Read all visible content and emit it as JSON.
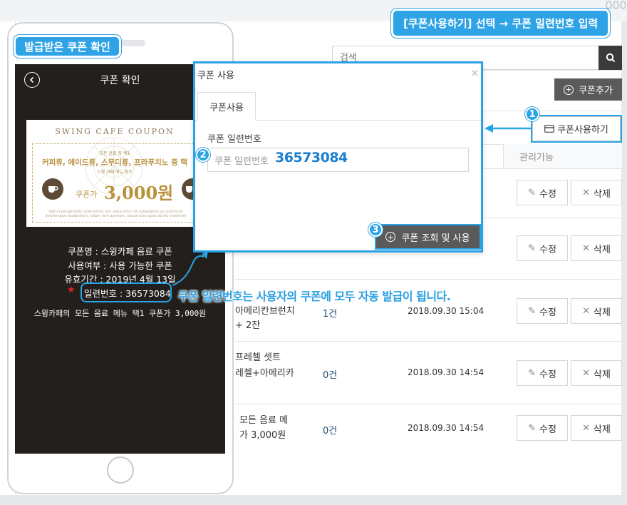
{
  "annotations": {
    "phone_tag": "발급받은 쿠폰 확인",
    "top_tag": "[쿠폰사용하기] 선택 → 쿠폰 일련번호 입력",
    "caption": "쿠폰 일련번호는 사용자의 쿠폰에 모두 자동 발급이 됩니다.",
    "step1": "1",
    "step2": "2",
    "step3": "3"
  },
  "phone": {
    "screen_title": "쿠폰 확인",
    "coupon": {
      "brand": "SWING CAFE COUPON",
      "subtitle": "모든 음료 중 택1",
      "menu": "커피류, 에이드류, 스무디류, 프라푸치노 중 택",
      "note": "스윙 카페 메뉴 참조",
      "price_label": "쿠폰가",
      "price": "3,000원",
      "fineprint": "Sed ut perspiciatis unde omnis iste natus error sit voluptatem accusantium doloremque laudantium, totam rem aperiam, eaque ipsa quae ab illo inventore"
    },
    "info": {
      "name": "쿠폰명 : 스윙카페 음료 쿠폰",
      "status": "사용여부 : 사용 가능한 쿠폰",
      "validity": "유효기간 : 2019년 4월 13일",
      "serial": "일련번호 : 36573084",
      "summary": "스윙카페의 모든 음료 메뉴 택1 쿠폰가 3,000원"
    }
  },
  "admin": {
    "search_placeholder": "검색",
    "add_coupon": "쿠폰추가",
    "use_coupon": "쿠폰사용하기",
    "col_mgmt": "관리기능",
    "edit": "수정",
    "delete": "삭제",
    "rows": [
      {
        "text1": "아메리칸브런치",
        "text2": "+ 2잔",
        "count": "1건",
        "date": "2018.09.30 15:04"
      },
      {
        "text1": "프레첼 셋트",
        "text2": "레첼+아메리카",
        "count": "0건",
        "date": "2018.09.30 14:54"
      },
      {
        "text1": "모든 음료 메",
        "text2": "가 3,000원",
        "count": "0건",
        "date": "2018.09.30 14:54"
      }
    ]
  },
  "modal": {
    "title": "쿠폰 사용",
    "close": "×",
    "tab": "쿠폰사용",
    "field_label": "쿠폰 일련번호",
    "placeholder": "쿠폰 일련번호",
    "serial_value": "36573084",
    "submit": "쿠폰 조회 및 사용"
  },
  "colors": {
    "accent": "#2ea3e6",
    "dark_button": "#5a5a5a",
    "phone_screen": "#231f1c",
    "coupon_gold": "#b9913c"
  }
}
